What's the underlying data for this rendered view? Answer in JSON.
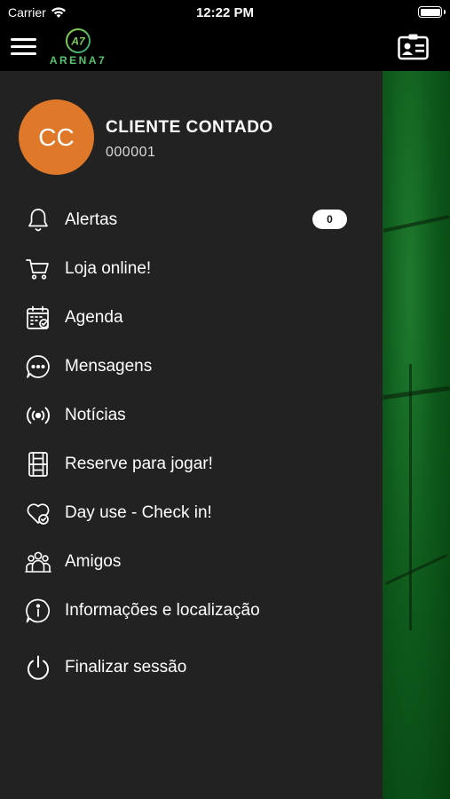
{
  "status_bar": {
    "carrier": "Carrier",
    "time": "12:22 PM"
  },
  "nav": {
    "logo_text": "ARENA7",
    "logo_mark": "A7",
    "brand_color": "#56c46f"
  },
  "user": {
    "initials": "CC",
    "name": "CLIENTE CONTADO",
    "id": "000001",
    "avatar_color": "#e0782a"
  },
  "menu": [
    {
      "icon": "bell-icon",
      "label": "Alertas",
      "badge": "0"
    },
    {
      "icon": "cart-icon",
      "label": "Loja online!"
    },
    {
      "icon": "calendar-check-icon",
      "label": "Agenda"
    },
    {
      "icon": "chat-bubble-icon",
      "label": "Mensagens"
    },
    {
      "icon": "broadcast-icon",
      "label": "Notícias"
    },
    {
      "icon": "court-icon",
      "label": "Reserve para jogar!"
    },
    {
      "icon": "heart-check-icon",
      "label": "Day use - Check in!"
    },
    {
      "icon": "friends-icon",
      "label": "Amigos"
    },
    {
      "icon": "info-icon",
      "label": "Informações e localização"
    },
    {
      "icon": "power-icon",
      "label": "Finalizar sessão"
    }
  ],
  "colors": {
    "drawer": "#222222",
    "background_green": "#0e5a1c"
  }
}
